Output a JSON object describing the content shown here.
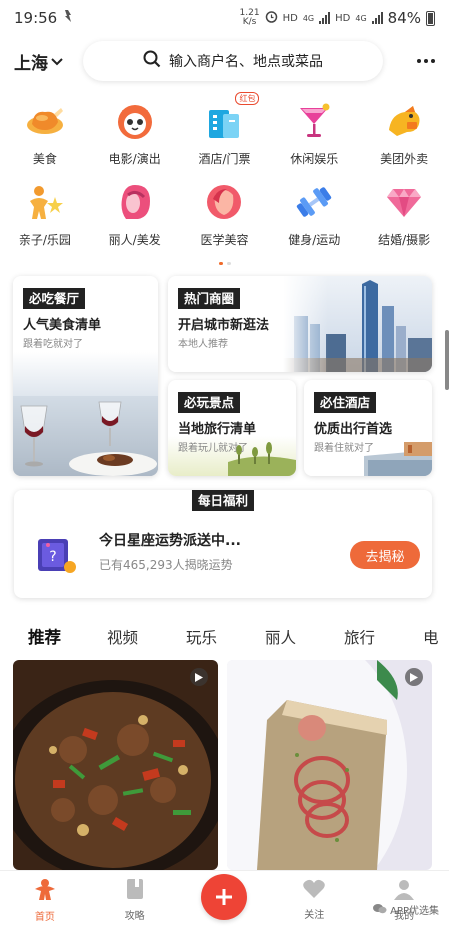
{
  "status_bar": {
    "time": "19:56",
    "net_speed_value": "1.21",
    "net_speed_unit": "K/s",
    "hd1": "HD",
    "g1": "4G",
    "hd2": "HD",
    "g2": "4G",
    "battery": "84%"
  },
  "header": {
    "city": "上海",
    "search_placeholder": "输入商户名、地点或菜品"
  },
  "categories": [
    {
      "label": "美食",
      "icon": "chicken-icon"
    },
    {
      "label": "电影/演出",
      "icon": "movie-cat-icon"
    },
    {
      "label": "酒店/门票",
      "icon": "hotel-icon",
      "badge": "红包"
    },
    {
      "label": "休闲娱乐",
      "icon": "cocktail-icon"
    },
    {
      "label": "美团外卖",
      "icon": "kangaroo-icon"
    },
    {
      "label": "亲子/乐园",
      "icon": "family-icon"
    },
    {
      "label": "丽人/美发",
      "icon": "beauty-icon"
    },
    {
      "label": "医学美容",
      "icon": "medical-beauty-icon"
    },
    {
      "label": "健身/运动",
      "icon": "dumbbell-icon"
    },
    {
      "label": "结婚/摄影",
      "icon": "wedding-icon"
    }
  ],
  "cards": {
    "food": {
      "tag": "必吃餐厅",
      "title": "人气美食清单",
      "sub": "跟着吃就对了"
    },
    "mall": {
      "tag": "热门商圈",
      "title": "开启城市新逛法",
      "sub": "本地人推荐"
    },
    "travel": {
      "tag": "必玩景点",
      "title": "当地旅行清单",
      "sub": "跟着玩儿就对了"
    },
    "hotel": {
      "tag": "必住酒店",
      "title": "优质出行首选",
      "sub": "跟着住就对了"
    }
  },
  "daily": {
    "tag": "每日福利",
    "title": "今日星座运势派送中...",
    "sub": "已有465,293人揭晓运势",
    "button": "去揭秘"
  },
  "tabs": [
    "推荐",
    "视频",
    "玩乐",
    "丽人",
    "旅行",
    "电"
  ],
  "bottom_nav": {
    "home": "首页",
    "guide": "攻略",
    "follow": "关注",
    "me": "我的"
  },
  "watermark": "APP优选集",
  "colors": {
    "accent": "#ee6a3a",
    "fab": "#ee4436",
    "tag_bg": "#222222"
  }
}
